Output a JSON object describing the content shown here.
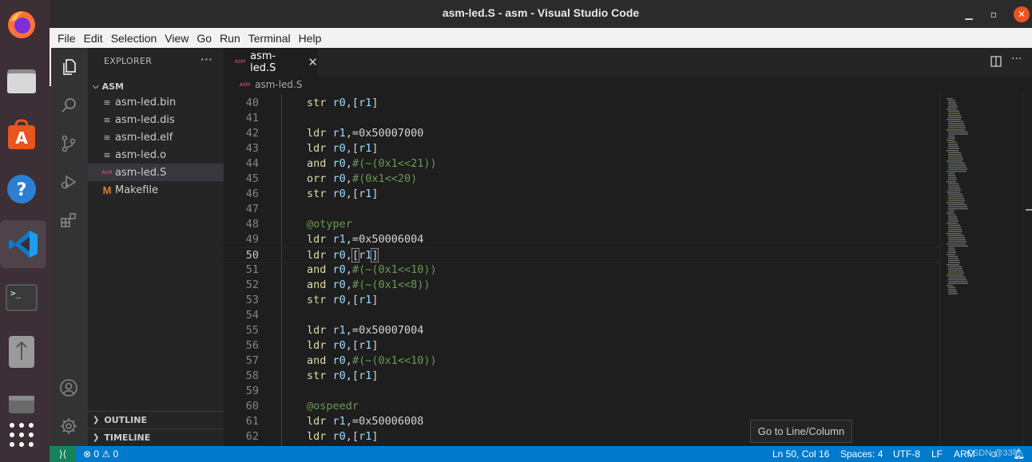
{
  "window": {
    "title": "asm-led.S - asm - Visual Studio Code"
  },
  "menu": [
    "File",
    "Edit",
    "Selection",
    "View",
    "Go",
    "Run",
    "Terminal",
    "Help"
  ],
  "dock": [
    {
      "name": "firefox-icon"
    },
    {
      "name": "files-icon"
    },
    {
      "name": "software-center-icon"
    },
    {
      "name": "help-icon"
    },
    {
      "name": "vscode-icon"
    },
    {
      "name": "terminal-icon"
    },
    {
      "name": "usb-drive-icon"
    },
    {
      "name": "drive-icon"
    },
    {
      "name": "show-apps-icon"
    }
  ],
  "sidebar": {
    "title": "EXPLORER",
    "more": "···",
    "folder": "ASM",
    "files": [
      {
        "label": "asm-led.bin",
        "icon": "≡"
      },
      {
        "label": "asm-led.dis",
        "icon": "≡"
      },
      {
        "label": "asm-led.elf",
        "icon": "≡"
      },
      {
        "label": "asm-led.o",
        "icon": "≡"
      },
      {
        "label": "asm-led.S",
        "icon": "ASM"
      },
      {
        "label": "Makefile",
        "icon": "M"
      }
    ],
    "outline": "OUTLINE",
    "timeline": "TIMELINE"
  },
  "editor": {
    "tab": {
      "label": "asm-led.S",
      "badge": "ASM",
      "close": "✕"
    },
    "breadcrumb": "asm-led.S",
    "current_line": 50,
    "lines": [
      {
        "n": 40,
        "code": "str r0,[r1]"
      },
      {
        "n": 41,
        "code": ""
      },
      {
        "n": 42,
        "code": "ldr r1,=0x50007000"
      },
      {
        "n": 43,
        "code": "ldr r0,[r1]"
      },
      {
        "n": 44,
        "code": "and r0,#(~(0x1<<21))"
      },
      {
        "n": 45,
        "code": "orr r0,#(0x1<<20)"
      },
      {
        "n": 46,
        "code": "str r0,[r1]"
      },
      {
        "n": 47,
        "code": ""
      },
      {
        "n": 48,
        "code": "@otyper"
      },
      {
        "n": 49,
        "code": "ldr r1,=0x50006004"
      },
      {
        "n": 50,
        "code": "ldr r0,[r1]"
      },
      {
        "n": 51,
        "code": "and r0,#(~(0x1<<10))"
      },
      {
        "n": 52,
        "code": "and r0,#(~(0x1<<8))"
      },
      {
        "n": 53,
        "code": "str r0,[r1]"
      },
      {
        "n": 54,
        "code": ""
      },
      {
        "n": 55,
        "code": "ldr r1,=0x50007004"
      },
      {
        "n": 56,
        "code": "ldr r0,[r1]"
      },
      {
        "n": 57,
        "code": "and r0,#(~(0x1<<10))"
      },
      {
        "n": 58,
        "code": "str r0,[r1]"
      },
      {
        "n": 59,
        "code": ""
      },
      {
        "n": 60,
        "code": "@ospeedr"
      },
      {
        "n": 61,
        "code": "ldr r1,=0x50006008"
      },
      {
        "n": 62,
        "code": "ldr r0,[r1]"
      }
    ]
  },
  "tooltip": "Go to Line/Column",
  "status": {
    "problems": "⊗ 0 ⚠ 0",
    "position": "Ln 50, Col 16",
    "spaces": "Spaces: 4",
    "encoding": "UTF-8",
    "eol": "LF",
    "language": "ARM",
    "watermark": "CSDN @33哈"
  }
}
